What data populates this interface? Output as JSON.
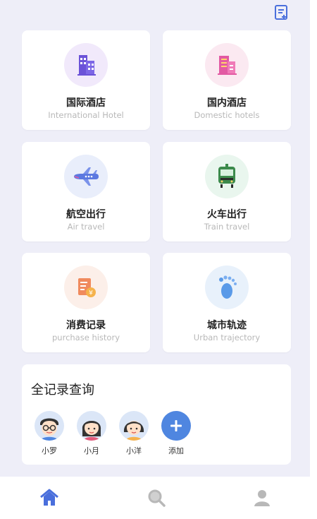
{
  "header": {
    "action_icon": "edit-list-icon"
  },
  "grid": [
    {
      "id": "intl",
      "title": "国际酒店",
      "subtitle": "International Hotel",
      "icon": "building-icon",
      "bg": "#f1e9fb",
      "color": "#6b52d8"
    },
    {
      "id": "dom",
      "title": "国内酒店",
      "subtitle": "Domestic hotels",
      "icon": "hotel-icon",
      "bg": "#fbe9f1",
      "color": "#e25aa3"
    },
    {
      "id": "air",
      "title": "航空出行",
      "subtitle": "Air travel",
      "icon": "airplane-icon",
      "bg": "#e9eefb",
      "color": "#5b78e0"
    },
    {
      "id": "train",
      "title": "火车出行",
      "subtitle": "Train travel",
      "icon": "train-icon",
      "bg": "#e9f6ee",
      "color": "#3c8a4c"
    },
    {
      "id": "purchase",
      "title": "消费记录",
      "subtitle": "purchase history",
      "icon": "receipt-icon",
      "bg": "#fcefe9",
      "color": "#f08a5d"
    },
    {
      "id": "urban",
      "title": "城市轨迹",
      "subtitle": "Urban trajectory",
      "icon": "footprint-icon",
      "bg": "#e8f1fb",
      "color": "#5a9ae8"
    }
  ],
  "records": {
    "title": "全记录查询",
    "people": [
      {
        "name": "小罗",
        "icon": "avatar-boy-glasses-icon"
      },
      {
        "name": "小月",
        "icon": "avatar-girl-icon"
      },
      {
        "name": "小洋",
        "icon": "avatar-girl2-icon"
      }
    ],
    "add_label": "添加"
  },
  "tabs": [
    {
      "name": "home",
      "icon": "home-icon",
      "color": "#4a6fdc"
    },
    {
      "name": "search",
      "icon": "search-icon",
      "color": "#b8b8b8"
    },
    {
      "name": "profile",
      "icon": "user-icon",
      "color": "#b8b8b8"
    }
  ],
  "colors": {
    "accent": "#4a6fdc",
    "background": "#eeeef8"
  }
}
